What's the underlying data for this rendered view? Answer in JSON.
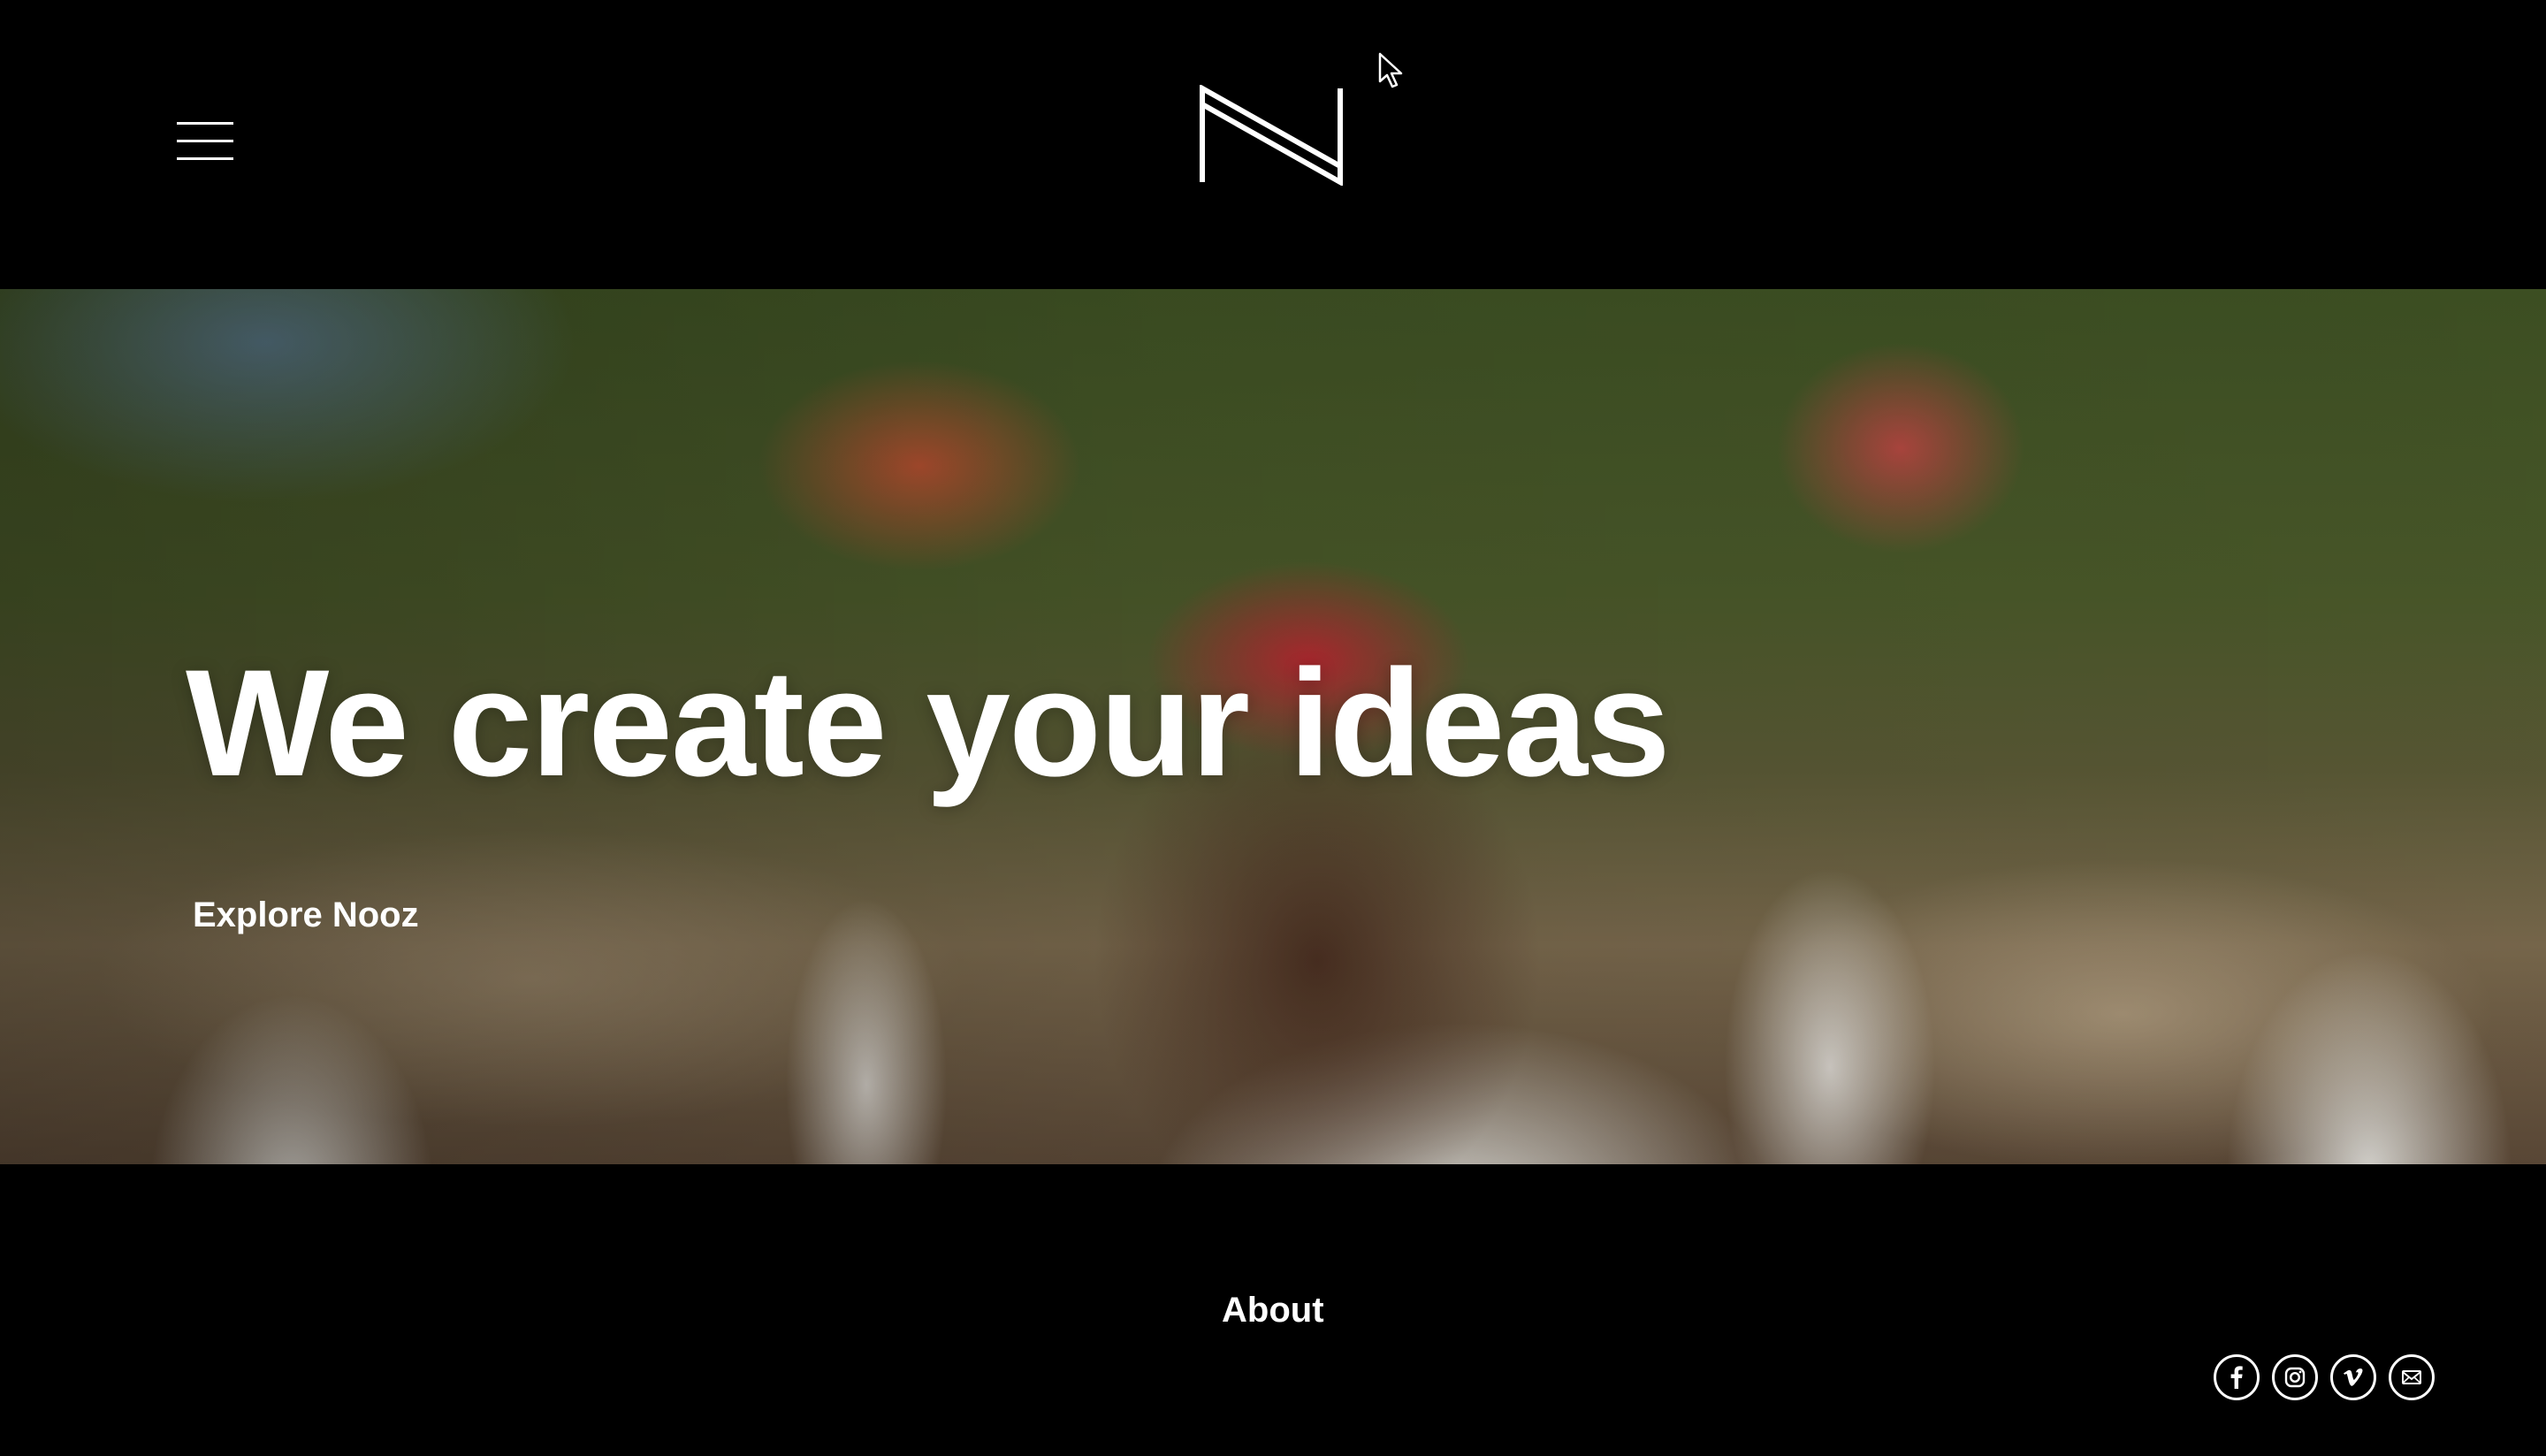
{
  "header": {
    "menu_icon": "hamburger-menu-icon",
    "logo_icon": "nooz-logo-icon"
  },
  "hero": {
    "headline": "We create your ideas",
    "cta_label": "Explore Nooz"
  },
  "footer": {
    "about_label": "About",
    "social": [
      {
        "icon": "facebook-icon"
      },
      {
        "icon": "instagram-icon"
      },
      {
        "icon": "vimeo-icon"
      },
      {
        "icon": "email-icon"
      }
    ]
  },
  "colors": {
    "background": "#000000",
    "text": "#ffffff"
  }
}
